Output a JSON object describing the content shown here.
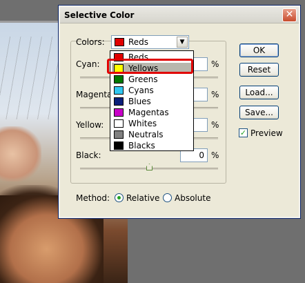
{
  "dialog": {
    "title": "Selective Color",
    "close_glyph": "✕"
  },
  "colors_row": {
    "label": "Colors:",
    "selected_value": "Reds",
    "selected_swatch": "#e00000"
  },
  "dropdown": {
    "items": [
      {
        "label": "Reds",
        "swatch": "#e00000"
      },
      {
        "label": "Yellows",
        "swatch": "#ffff00"
      },
      {
        "label": "Greens",
        "swatch": "#007800"
      },
      {
        "label": "Cyans",
        "swatch": "#31c7f1"
      },
      {
        "label": "Blues",
        "swatch": "#0a1f7a"
      },
      {
        "label": "Magentas",
        "swatch": "#c800c8"
      },
      {
        "label": "Whites",
        "swatch": "#ffffff"
      },
      {
        "label": "Neutrals",
        "swatch": "#808080"
      },
      {
        "label": "Blacks",
        "swatch": "#000000"
      }
    ],
    "highlighted_index": 1
  },
  "sliders": {
    "cyan": {
      "label": "Cyan:",
      "value": "",
      "unit": "%"
    },
    "magenta": {
      "label": "Magenta",
      "value": "",
      "unit": "%"
    },
    "yellow": {
      "label": "Yellow:",
      "value": "",
      "unit": "%"
    },
    "black": {
      "label": "Black:",
      "value": "0",
      "unit": "%"
    }
  },
  "buttons": {
    "ok": "OK",
    "reset": "Reset",
    "load": "Load...",
    "save": "Save..."
  },
  "preview": {
    "label": "Preview",
    "checked": true,
    "check_glyph": "✓"
  },
  "method": {
    "label": "Method:",
    "relative": "Relative",
    "absolute": "Absolute",
    "selected": "Relative"
  },
  "colors": {
    "dialog_bg": "#ece9d8",
    "highlight": "#e00000",
    "accent": "#003c74"
  }
}
